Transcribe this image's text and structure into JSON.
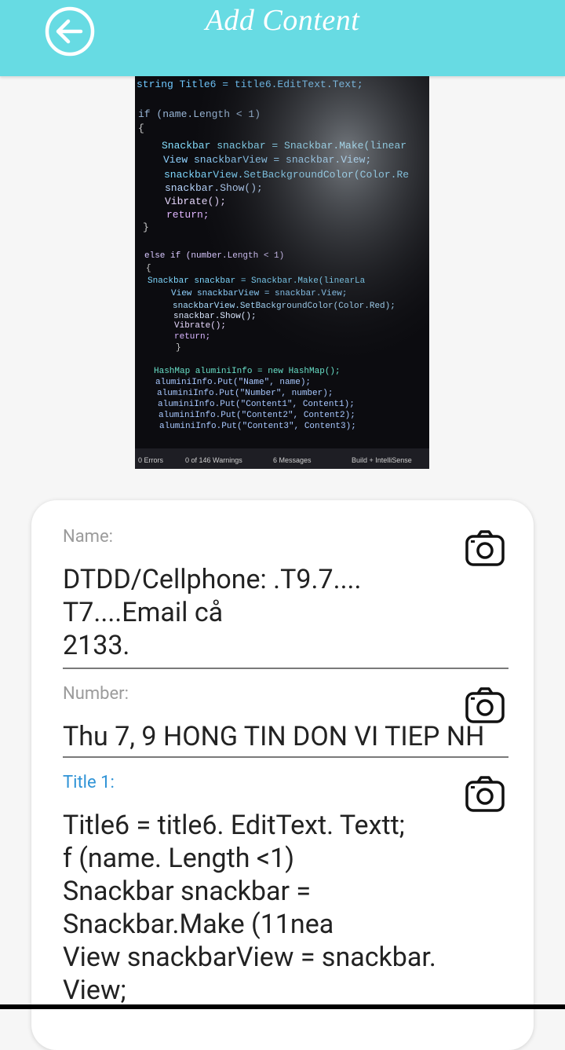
{
  "app_bar": {
    "title": "Add Content",
    "background_color": "#67dbe3",
    "back_icon": "arrow-left-circle-icon"
  },
  "photo": {
    "code_lines": [
      "string Title6 = title6.EditText.Text;",
      "if (name.Length < 1)",
      "{",
      "Snackbar snackbar = Snackbar.Make(linear",
      "View snackbarView = snackbar.View;",
      "snackbarView.SetBackgroundColor(Color.Re",
      "snackbar.Show();",
      "Vibrate();",
      "return;",
      "}",
      "else if (number.Length < 1)",
      "{",
      "Snackbar snackbar = Snackbar.Make(linearLa",
      "View snackbarView = snackbar.View;",
      "snackbarView.SetBackgroundColor(Color.Red);",
      "snackbar.Show();",
      "Vibrate();",
      "return;",
      "}",
      "HashMap aluminiInfo = new HashMap();",
      "aluminiInfo.Put(\"Name\", name);",
      "aluminiInfo.Put(\"Number\", number);",
      "aluminiInfo.Put(\"Content1\", Content1);",
      "aluminiInfo.Put(\"Content2\", Content2);",
      "aluminiInfo.Put(\"Content3\", Content3);"
    ],
    "status_bar": {
      "errors": "0 Errors",
      "warnings": "0 of 146 Warnings",
      "messages": "6 Messages",
      "build": "Build + IntelliSense"
    }
  },
  "form": {
    "name": {
      "label": "Name:",
      "value": "DTDD/Cellphone: .T9.7....\nT7....Email cå\n2133.",
      "camera_icon": "camera-icon"
    },
    "number": {
      "label": "Number:",
      "value": "Thu 7, 9 HONG TIN DON VI TIEP NH",
      "camera_icon": "camera-icon"
    },
    "title1": {
      "label": "Title 1:",
      "value": "Title6 = title6. EditText. Textt;\nf (name. Length <1)\nSnackbar snackbar =\nSnackbar.Make (11nea\nView snackbarView = snackbar.\nView;",
      "camera_icon": "camera-icon",
      "label_color": "#2f93d6"
    }
  }
}
